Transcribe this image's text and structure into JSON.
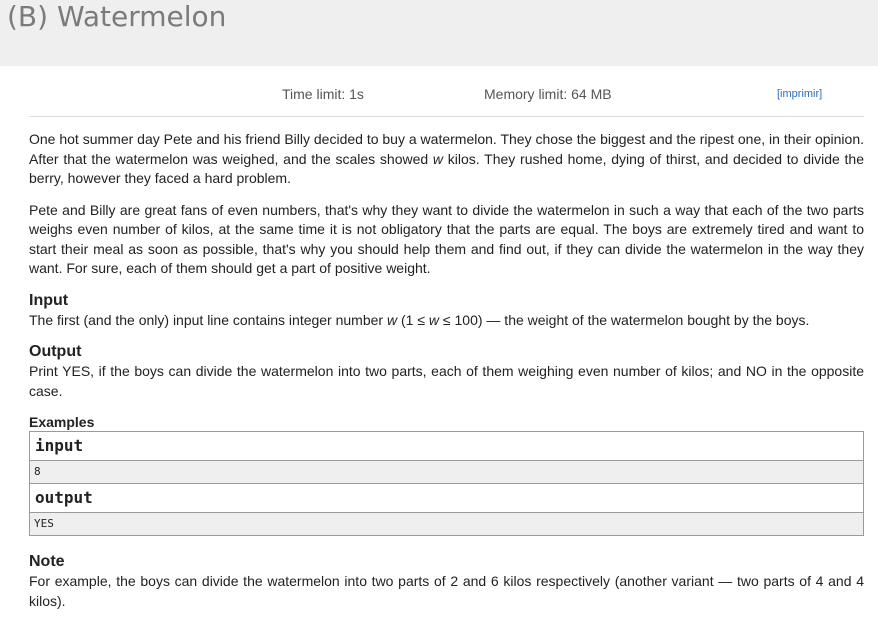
{
  "problem": {
    "title": "(B) Watermelon",
    "time_limit": "Time limit: 1s",
    "memory_limit": "Memory limit: 64 MB",
    "print_link": "[imprimir]"
  },
  "statement": {
    "p1_before": "One hot summer day Pete and his friend Billy decided to buy a watermelon. They chose the biggest and the ripest one, in their opinion. After that the watermelon was weighed, and the scales showed ",
    "p1_var": "w",
    "p1_after": " kilos. They rushed home, dying of thirst, and decided to divide the berry, however they faced a hard problem.",
    "p2": "Pete and Billy are great fans of even numbers, that's why they want to divide the watermelon in such a way that each of the two parts weighs even number of kilos, at the same time it is not obligatory that the parts are equal. The boys are extremely tired and want to start their meal as soon as possible, that's why you should help them and find out, if they can divide the watermelon in the way they want. For sure, each of them should get a part of positive weight."
  },
  "input": {
    "title": "Input",
    "text_before": "The first (and the only) input line contains integer number ",
    "var1": "w",
    "text_mid1": " (1 ≤ ",
    "var2": "w",
    "text_mid2": " ≤ 100) — the weight of the watermelon bought by the boys."
  },
  "output": {
    "title": "Output",
    "text": "Print YES, if the boys can divide the watermelon into two parts, each of them weighing even number of kilos; and NO in the opposite case."
  },
  "examples": {
    "title": "Examples",
    "input_label": "input",
    "input_value": "8",
    "output_label": "output",
    "output_value": "YES"
  },
  "note": {
    "title": "Note",
    "text": "For example, the boys can divide the watermelon into two parts of 2 and 6 kilos respectively (another variant — two parts of 4 and 4 kilos)."
  }
}
